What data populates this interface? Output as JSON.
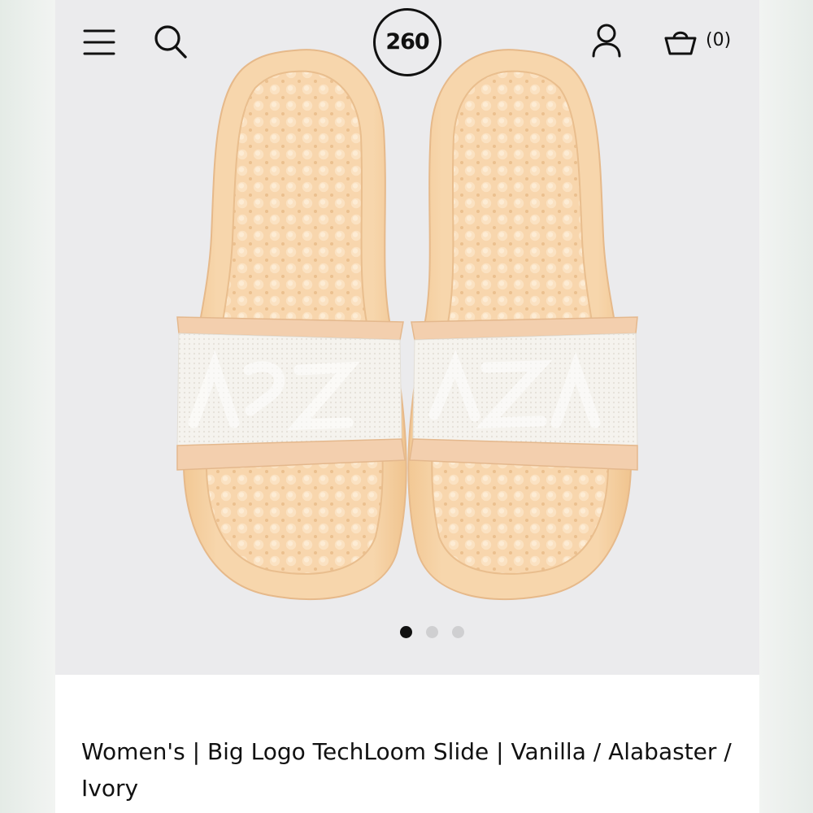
{
  "header": {
    "menu_icon": "hamburger-menu-icon",
    "search_icon": "search-icon",
    "logo_text": "260",
    "account_icon": "user-icon",
    "cart_icon": "shopping-basket-icon",
    "cart_count": "(0)"
  },
  "gallery": {
    "image_subject": "Pair of vanilla slides with white woven big-logo strap",
    "total_images": 3,
    "active_index": 0
  },
  "product": {
    "title": "Women's | Big Logo TechLoom Slide | Vanilla / Alabaster / Ivory"
  },
  "colors": {
    "sole": "#f6d5a9",
    "strap_mesh": "#f4f1ec",
    "strap_band": "#f3cfae",
    "active_dot": "#111111",
    "inactive_dot": "#cfcfd1",
    "header_bg": "#ebebed"
  }
}
